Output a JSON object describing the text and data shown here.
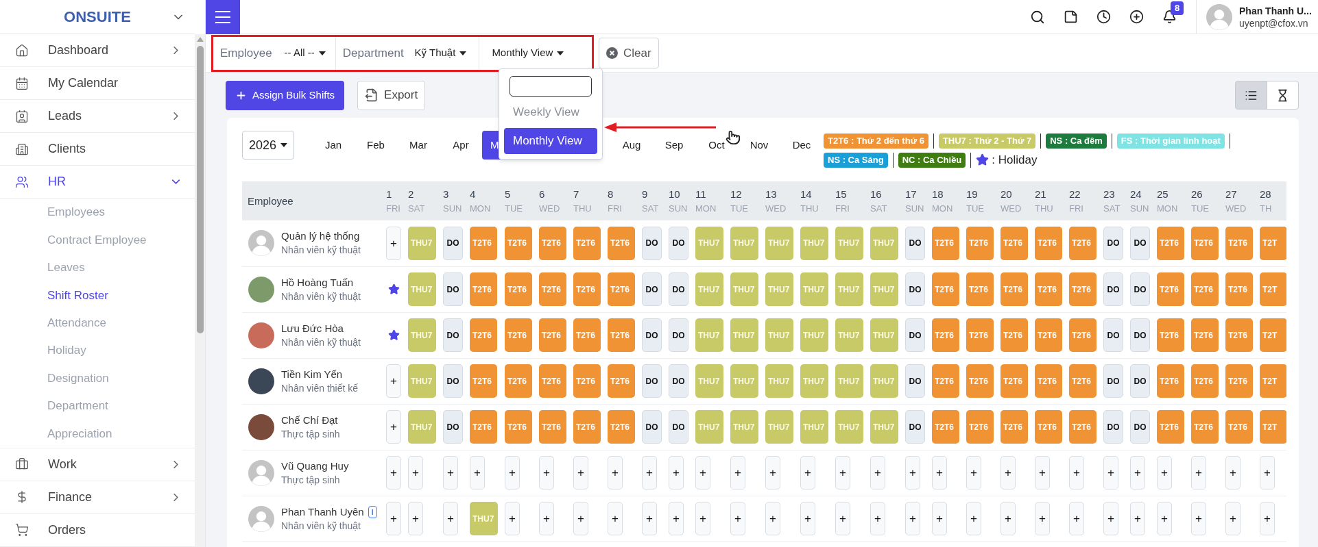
{
  "sidebar": {
    "logo": "ONSUITE",
    "items": [
      {
        "label": "Dashboard",
        "expanded": false
      },
      {
        "label": "My Calendar"
      },
      {
        "label": "Leads",
        "expanded": false
      },
      {
        "label": "Clients"
      },
      {
        "label": "HR",
        "expanded": true,
        "children": [
          {
            "label": "Employees",
            "selected": false
          },
          {
            "label": "Contract Employee",
            "selected": false
          },
          {
            "label": "Leaves",
            "selected": false
          },
          {
            "label": "Shift Roster",
            "selected": true
          },
          {
            "label": "Attendance",
            "selected": false
          },
          {
            "label": "Holiday",
            "selected": false
          },
          {
            "label": "Designation",
            "selected": false
          },
          {
            "label": "Department",
            "selected": false
          },
          {
            "label": "Appreciation",
            "selected": false
          }
        ]
      },
      {
        "label": "Work",
        "expanded": false
      },
      {
        "label": "Finance",
        "expanded": false
      },
      {
        "label": "Orders"
      }
    ]
  },
  "topbar": {
    "notification_count": "8",
    "user": {
      "name": "Phan Thanh U...",
      "email": "uyenpt@cfox.vn"
    }
  },
  "filters": {
    "employee": {
      "label": "Employee",
      "value": "-- All --"
    },
    "department": {
      "label": "Department",
      "value": "Kỹ Thuật"
    },
    "view": {
      "value": "Monthly View"
    },
    "clear_button": "Clear"
  },
  "view_menu": {
    "options": [
      {
        "label": "Weekly View",
        "selected": false
      },
      {
        "label": "Monthly View",
        "selected": true
      }
    ]
  },
  "toolbar": {
    "assign_button": "Assign Bulk Shifts",
    "export_button": "Export",
    "view_toggle": [
      {
        "selected": true
      },
      {
        "selected": false
      }
    ]
  },
  "year": "2026",
  "months": [
    {
      "label": "Jan",
      "selected": false
    },
    {
      "label": "Feb",
      "selected": false
    },
    {
      "label": "Mar",
      "selected": false
    },
    {
      "label": "Apr",
      "selected": false
    },
    {
      "label": "M",
      "selected": true
    },
    {
      "label": "Aug",
      "selected": false
    },
    {
      "label": "Sep",
      "selected": false
    },
    {
      "label": "Oct",
      "selected": false
    },
    {
      "label": "Nov",
      "selected": false
    },
    {
      "label": "Dec",
      "selected": false
    }
  ],
  "legend": [
    {
      "kind": "shift",
      "label": "T2T6 : Thứ 2 đến thứ 6",
      "color": "#ef9334"
    },
    {
      "kind": "shift",
      "label": "THU7 : Thứ 2 - Thứ 7",
      "color": "#c8ca68"
    },
    {
      "kind": "shift",
      "label": "NS : Ca đêm",
      "color": "#1e7b3e"
    },
    {
      "kind": "shift",
      "label": "FS : Thời gian linh hoạt",
      "color": "#7fe3e3"
    },
    {
      "kind": "shift",
      "label": "NS : Ca Sáng",
      "color": "#1b9fd7"
    },
    {
      "kind": "shift",
      "label": "NC : Ca Chiều",
      "color": "#3f7d13"
    },
    {
      "kind": "holiday",
      "label": ": Holiday"
    }
  ],
  "table": {
    "header": "Employee",
    "days": [
      {
        "day": "1",
        "weekday": "FRI"
      },
      {
        "day": "2",
        "weekday": "SAT"
      },
      {
        "day": "3",
        "weekday": "SUN"
      },
      {
        "day": "4",
        "weekday": "MON"
      },
      {
        "day": "5",
        "weekday": "TUE"
      },
      {
        "day": "6",
        "weekday": "WED"
      },
      {
        "day": "7",
        "weekday": "THU"
      },
      {
        "day": "8",
        "weekday": "FRI"
      },
      {
        "day": "9",
        "weekday": "SAT"
      },
      {
        "day": "10",
        "weekday": "SUN"
      },
      {
        "day": "11",
        "weekday": "MON"
      },
      {
        "day": "12",
        "weekday": "TUE"
      },
      {
        "day": "13",
        "weekday": "WED"
      },
      {
        "day": "14",
        "weekday": "THU"
      },
      {
        "day": "15",
        "weekday": "FRI"
      },
      {
        "day": "16",
        "weekday": "SAT"
      },
      {
        "day": "17",
        "weekday": "SUN"
      },
      {
        "day": "18",
        "weekday": "MON"
      },
      {
        "day": "19",
        "weekday": "TUE"
      },
      {
        "day": "20",
        "weekday": "WED"
      },
      {
        "day": "21",
        "weekday": "THU"
      },
      {
        "day": "22",
        "weekday": "FRI"
      },
      {
        "day": "23",
        "weekday": "SAT"
      },
      {
        "day": "24",
        "weekday": "SUN"
      },
      {
        "day": "25",
        "weekday": "MON"
      },
      {
        "day": "26",
        "weekday": "TUE"
      },
      {
        "day": "27",
        "weekday": "WED"
      },
      {
        "day": "28",
        "weekday": "TH"
      }
    ],
    "rows": [
      {
        "name": "Quản lý hệ thống",
        "role": "Nhân viên kỹ thuật",
        "avatar": {
          "kind": "default"
        },
        "cells": [
          {
            "kind": "add",
            "label": "+"
          },
          {
            "kind": "thu7",
            "label": "THU7"
          },
          {
            "kind": "off",
            "label": "DO"
          },
          {
            "kind": "t2t6",
            "label": "T2T6"
          },
          {
            "kind": "t2t6",
            "label": "T2T6"
          },
          {
            "kind": "t2t6",
            "label": "T2T6"
          },
          {
            "kind": "t2t6",
            "label": "T2T6"
          },
          {
            "kind": "t2t6",
            "label": "T2T6"
          },
          {
            "kind": "off",
            "label": "DO"
          },
          {
            "kind": "off",
            "label": "DO"
          },
          {
            "kind": "thu7",
            "label": "THU7"
          },
          {
            "kind": "thu7",
            "label": "THU7"
          },
          {
            "kind": "thu7",
            "label": "THU7"
          },
          {
            "kind": "thu7",
            "label": "THU7"
          },
          {
            "kind": "thu7",
            "label": "THU7"
          },
          {
            "kind": "thu7",
            "label": "THU7"
          },
          {
            "kind": "off",
            "label": "DO"
          },
          {
            "kind": "t2t6",
            "label": "T2T6"
          },
          {
            "kind": "t2t6",
            "label": "T2T6"
          },
          {
            "kind": "t2t6",
            "label": "T2T6"
          },
          {
            "kind": "t2t6",
            "label": "T2T6"
          },
          {
            "kind": "t2t6",
            "label": "T2T6"
          },
          {
            "kind": "off",
            "label": "DO"
          },
          {
            "kind": "off",
            "label": "DO"
          },
          {
            "kind": "t2t6",
            "label": "T2T6"
          },
          {
            "kind": "t2t6",
            "label": "T2T6"
          },
          {
            "kind": "t2t6",
            "label": "T2T6"
          },
          {
            "kind": "t2t6",
            "label": "T2T"
          }
        ]
      },
      {
        "name": "Hồ Hoàng Tuấn",
        "role": "Nhân viên kỹ thuật",
        "avatar": {
          "kind": "photo"
        },
        "cells": [
          {
            "kind": "holiday"
          },
          {
            "kind": "thu7",
            "label": "THU7"
          },
          {
            "kind": "off",
            "label": "DO"
          },
          {
            "kind": "t2t6",
            "label": "T2T6"
          },
          {
            "kind": "t2t6",
            "label": "T2T6"
          },
          {
            "kind": "t2t6",
            "label": "T2T6"
          },
          {
            "kind": "t2t6",
            "label": "T2T6"
          },
          {
            "kind": "t2t6",
            "label": "T2T6"
          },
          {
            "kind": "off",
            "label": "DO"
          },
          {
            "kind": "off",
            "label": "DO"
          },
          {
            "kind": "thu7",
            "label": "THU7"
          },
          {
            "kind": "thu7",
            "label": "THU7"
          },
          {
            "kind": "thu7",
            "label": "THU7"
          },
          {
            "kind": "thu7",
            "label": "THU7"
          },
          {
            "kind": "thu7",
            "label": "THU7"
          },
          {
            "kind": "thu7",
            "label": "THU7"
          },
          {
            "kind": "off",
            "label": "DO"
          },
          {
            "kind": "t2t6",
            "label": "T2T6"
          },
          {
            "kind": "t2t6",
            "label": "T2T6"
          },
          {
            "kind": "t2t6",
            "label": "T2T6"
          },
          {
            "kind": "t2t6",
            "label": "T2T6"
          },
          {
            "kind": "t2t6",
            "label": "T2T6"
          },
          {
            "kind": "off",
            "label": "DO"
          },
          {
            "kind": "off",
            "label": "DO"
          },
          {
            "kind": "t2t6",
            "label": "T2T6"
          },
          {
            "kind": "t2t6",
            "label": "T2T6"
          },
          {
            "kind": "t2t6",
            "label": "T2T6"
          },
          {
            "kind": "t2t6",
            "label": "T2T"
          }
        ]
      },
      {
        "name": "Lưu Đức Hòa",
        "role": "Nhân viên kỹ thuật",
        "avatar": {
          "kind": "photo"
        },
        "cells": [
          {
            "kind": "holiday"
          },
          {
            "kind": "thu7",
            "label": "THU7"
          },
          {
            "kind": "off",
            "label": "DO"
          },
          {
            "kind": "t2t6",
            "label": "T2T6"
          },
          {
            "kind": "t2t6",
            "label": "T2T6"
          },
          {
            "kind": "t2t6",
            "label": "T2T6"
          },
          {
            "kind": "t2t6",
            "label": "T2T6"
          },
          {
            "kind": "t2t6",
            "label": "T2T6"
          },
          {
            "kind": "off",
            "label": "DO"
          },
          {
            "kind": "off",
            "label": "DO"
          },
          {
            "kind": "thu7",
            "label": "THU7"
          },
          {
            "kind": "thu7",
            "label": "THU7"
          },
          {
            "kind": "thu7",
            "label": "THU7"
          },
          {
            "kind": "thu7",
            "label": "THU7"
          },
          {
            "kind": "thu7",
            "label": "THU7"
          },
          {
            "kind": "thu7",
            "label": "THU7"
          },
          {
            "kind": "off",
            "label": "DO"
          },
          {
            "kind": "t2t6",
            "label": "T2T6"
          },
          {
            "kind": "t2t6",
            "label": "T2T6"
          },
          {
            "kind": "t2t6",
            "label": "T2T6"
          },
          {
            "kind": "t2t6",
            "label": "T2T6"
          },
          {
            "kind": "t2t6",
            "label": "T2T6"
          },
          {
            "kind": "off",
            "label": "DO"
          },
          {
            "kind": "off",
            "label": "DO"
          },
          {
            "kind": "t2t6",
            "label": "T2T6"
          },
          {
            "kind": "t2t6",
            "label": "T2T6"
          },
          {
            "kind": "t2t6",
            "label": "T2T6"
          },
          {
            "kind": "t2t6",
            "label": "T2T"
          }
        ]
      },
      {
        "name": "Tiền Kim Yến",
        "role": "Nhân viên thiết kế",
        "avatar": {
          "kind": "photo"
        },
        "cells": [
          {
            "kind": "add",
            "label": "+"
          },
          {
            "kind": "thu7",
            "label": "THU7"
          },
          {
            "kind": "off",
            "label": "DO"
          },
          {
            "kind": "t2t6",
            "label": "T2T6"
          },
          {
            "kind": "t2t6",
            "label": "T2T6"
          },
          {
            "kind": "t2t6",
            "label": "T2T6"
          },
          {
            "kind": "t2t6",
            "label": "T2T6"
          },
          {
            "kind": "t2t6",
            "label": "T2T6"
          },
          {
            "kind": "off",
            "label": "DO"
          },
          {
            "kind": "off",
            "label": "DO"
          },
          {
            "kind": "thu7",
            "label": "THU7"
          },
          {
            "kind": "thu7",
            "label": "THU7"
          },
          {
            "kind": "thu7",
            "label": "THU7"
          },
          {
            "kind": "thu7",
            "label": "THU7"
          },
          {
            "kind": "thu7",
            "label": "THU7"
          },
          {
            "kind": "thu7",
            "label": "THU7"
          },
          {
            "kind": "off",
            "label": "DO"
          },
          {
            "kind": "t2t6",
            "label": "T2T6"
          },
          {
            "kind": "t2t6",
            "label": "T2T6"
          },
          {
            "kind": "t2t6",
            "label": "T2T6"
          },
          {
            "kind": "t2t6",
            "label": "T2T6"
          },
          {
            "kind": "t2t6",
            "label": "T2T6"
          },
          {
            "kind": "off",
            "label": "DO"
          },
          {
            "kind": "off",
            "label": "DO"
          },
          {
            "kind": "t2t6",
            "label": "T2T6"
          },
          {
            "kind": "t2t6",
            "label": "T2T6"
          },
          {
            "kind": "t2t6",
            "label": "T2T6"
          },
          {
            "kind": "t2t6",
            "label": "T2T"
          }
        ]
      },
      {
        "name": "Chế Chí Đạt",
        "role": "Thực tập sinh",
        "avatar": {
          "kind": "photo"
        },
        "cells": [
          {
            "kind": "add",
            "label": "+"
          },
          {
            "kind": "thu7",
            "label": "THU7"
          },
          {
            "kind": "off",
            "label": "DO"
          },
          {
            "kind": "t2t6",
            "label": "T2T6"
          },
          {
            "kind": "t2t6",
            "label": "T2T6"
          },
          {
            "kind": "t2t6",
            "label": "T2T6"
          },
          {
            "kind": "t2t6",
            "label": "T2T6"
          },
          {
            "kind": "t2t6",
            "label": "T2T6"
          },
          {
            "kind": "off",
            "label": "DO"
          },
          {
            "kind": "off",
            "label": "DO"
          },
          {
            "kind": "thu7",
            "label": "THU7"
          },
          {
            "kind": "thu7",
            "label": "THU7"
          },
          {
            "kind": "thu7",
            "label": "THU7"
          },
          {
            "kind": "thu7",
            "label": "THU7"
          },
          {
            "kind": "thu7",
            "label": "THU7"
          },
          {
            "kind": "thu7",
            "label": "THU7"
          },
          {
            "kind": "off",
            "label": "DO"
          },
          {
            "kind": "t2t6",
            "label": "T2T6"
          },
          {
            "kind": "t2t6",
            "label": "T2T6"
          },
          {
            "kind": "t2t6",
            "label": "T2T6"
          },
          {
            "kind": "t2t6",
            "label": "T2T6"
          },
          {
            "kind": "t2t6",
            "label": "T2T6"
          },
          {
            "kind": "off",
            "label": "DO"
          },
          {
            "kind": "off",
            "label": "DO"
          },
          {
            "kind": "t2t6",
            "label": "T2T6"
          },
          {
            "kind": "t2t6",
            "label": "T2T6"
          },
          {
            "kind": "t2t6",
            "label": "T2T6"
          },
          {
            "kind": "t2t6",
            "label": "T2T"
          }
        ]
      },
      {
        "name": "Vũ Quang Huy",
        "role": "Thực tập sinh",
        "avatar": {
          "kind": "default"
        },
        "cells": [
          {
            "kind": "add",
            "label": "+"
          },
          {
            "kind": "add",
            "label": "+"
          },
          {
            "kind": "add",
            "label": "+"
          },
          {
            "kind": "add",
            "label": "+"
          },
          {
            "kind": "add",
            "label": "+"
          },
          {
            "kind": "add",
            "label": "+"
          },
          {
            "kind": "add",
            "label": "+"
          },
          {
            "kind": "add",
            "label": "+"
          },
          {
            "kind": "add",
            "label": "+"
          },
          {
            "kind": "add",
            "label": "+"
          },
          {
            "kind": "add",
            "label": "+"
          },
          {
            "kind": "add",
            "label": "+"
          },
          {
            "kind": "add",
            "label": "+"
          },
          {
            "kind": "add",
            "label": "+"
          },
          {
            "kind": "add",
            "label": "+"
          },
          {
            "kind": "add",
            "label": "+"
          },
          {
            "kind": "add",
            "label": "+"
          },
          {
            "kind": "add",
            "label": "+"
          },
          {
            "kind": "add",
            "label": "+"
          },
          {
            "kind": "add",
            "label": "+"
          },
          {
            "kind": "add",
            "label": "+"
          },
          {
            "kind": "add",
            "label": "+"
          },
          {
            "kind": "add",
            "label": "+"
          },
          {
            "kind": "add",
            "label": "+"
          },
          {
            "kind": "add",
            "label": "+"
          },
          {
            "kind": "add",
            "label": "+"
          },
          {
            "kind": "add",
            "label": "+"
          },
          {
            "kind": "add",
            "label": "+"
          }
        ]
      },
      {
        "name": "Phan Thanh Uyên",
        "role": "Nhân viên kỹ thuật",
        "avatar": {
          "kind": "default"
        },
        "badge": "I",
        "cells": [
          {
            "kind": "add",
            "label": "+"
          },
          {
            "kind": "add",
            "label": "+"
          },
          {
            "kind": "add",
            "label": "+"
          },
          {
            "kind": "thu7",
            "label": "THU7"
          },
          {
            "kind": "add",
            "label": "+"
          },
          {
            "kind": "add",
            "label": "+"
          },
          {
            "kind": "add",
            "label": "+"
          },
          {
            "kind": "add",
            "label": "+"
          },
          {
            "kind": "add",
            "label": "+"
          },
          {
            "kind": "add",
            "label": "+"
          },
          {
            "kind": "add",
            "label": "+"
          },
          {
            "kind": "add",
            "label": "+"
          },
          {
            "kind": "add",
            "label": "+"
          },
          {
            "kind": "add",
            "label": "+"
          },
          {
            "kind": "add",
            "label": "+"
          },
          {
            "kind": "add",
            "label": "+"
          },
          {
            "kind": "add",
            "label": "+"
          },
          {
            "kind": "add",
            "label": "+"
          },
          {
            "kind": "add",
            "label": "+"
          },
          {
            "kind": "add",
            "label": "+"
          },
          {
            "kind": "add",
            "label": "+"
          },
          {
            "kind": "add",
            "label": "+"
          },
          {
            "kind": "add",
            "label": "+"
          },
          {
            "kind": "add",
            "label": "+"
          },
          {
            "kind": "add",
            "label": "+"
          },
          {
            "kind": "add",
            "label": "+"
          },
          {
            "kind": "add",
            "label": "+"
          },
          {
            "kind": "add",
            "label": "+"
          }
        ]
      }
    ]
  }
}
